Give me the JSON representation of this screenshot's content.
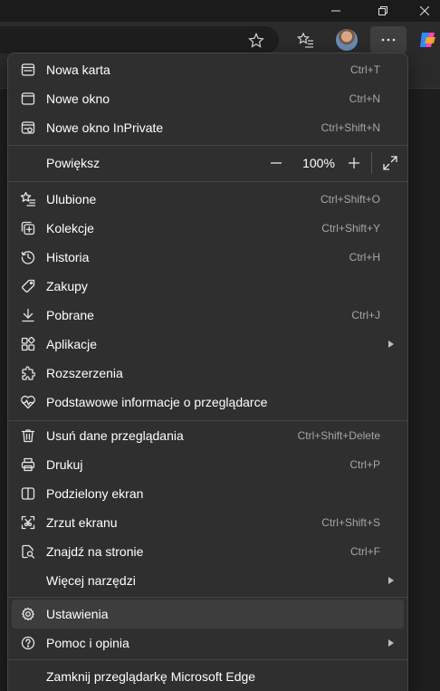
{
  "menu": {
    "items": [
      {
        "label": "Nowa karta",
        "shortcut": "Ctrl+T",
        "icon": "new-tab-icon"
      },
      {
        "label": "Nowe okno",
        "shortcut": "Ctrl+N",
        "icon": "new-window-icon"
      },
      {
        "label": "Nowe okno InPrivate",
        "shortcut": "Ctrl+Shift+N",
        "icon": "inprivate-icon"
      },
      {
        "label": "Powiększ",
        "zoom": "100%"
      },
      {
        "label": "Ulubione",
        "shortcut": "Ctrl+Shift+O",
        "icon": "favorites-icon"
      },
      {
        "label": "Kolekcje",
        "shortcut": "Ctrl+Shift+Y",
        "icon": "collections-icon"
      },
      {
        "label": "Historia",
        "shortcut": "Ctrl+H",
        "icon": "history-icon"
      },
      {
        "label": "Zakupy",
        "shortcut": "",
        "icon": "shopping-tag-icon"
      },
      {
        "label": "Pobrane",
        "shortcut": "Ctrl+J",
        "icon": "download-icon"
      },
      {
        "label": "Aplikacje",
        "shortcut": "",
        "icon": "apps-icon"
      },
      {
        "label": "Rozszerzenia",
        "shortcut": "",
        "icon": "extensions-icon"
      },
      {
        "label": "Podstawowe informacje o przeglądarce",
        "shortcut": "",
        "icon": "browser-essentials-icon"
      },
      {
        "label": "Usuń dane przeglądania",
        "shortcut": "Ctrl+Shift+Delete",
        "icon": "trash-icon"
      },
      {
        "label": "Drukuj",
        "shortcut": "Ctrl+P",
        "icon": "print-icon"
      },
      {
        "label": "Podzielony ekran",
        "shortcut": "",
        "icon": "split-screen-icon"
      },
      {
        "label": "Zrzut ekranu",
        "shortcut": "Ctrl+Shift+S",
        "icon": "screenshot-icon"
      },
      {
        "label": "Znajdź na stronie",
        "shortcut": "Ctrl+F",
        "icon": "find-icon"
      },
      {
        "label": "Więcej narzędzi",
        "shortcut": ""
      },
      {
        "label": "Ustawienia",
        "shortcut": "",
        "icon": "settings-gear-icon"
      },
      {
        "label": "Pomoc i opinia",
        "shortcut": "",
        "icon": "help-icon"
      },
      {
        "label": "Zamknij przeglądarkę Microsoft Edge",
        "shortcut": ""
      }
    ]
  },
  "colors": {
    "menu_bg": "#2f2f2f",
    "active_item": "#3d3d3d",
    "shortcut_text": "#a6a6a6",
    "page_bg": "#202020"
  }
}
